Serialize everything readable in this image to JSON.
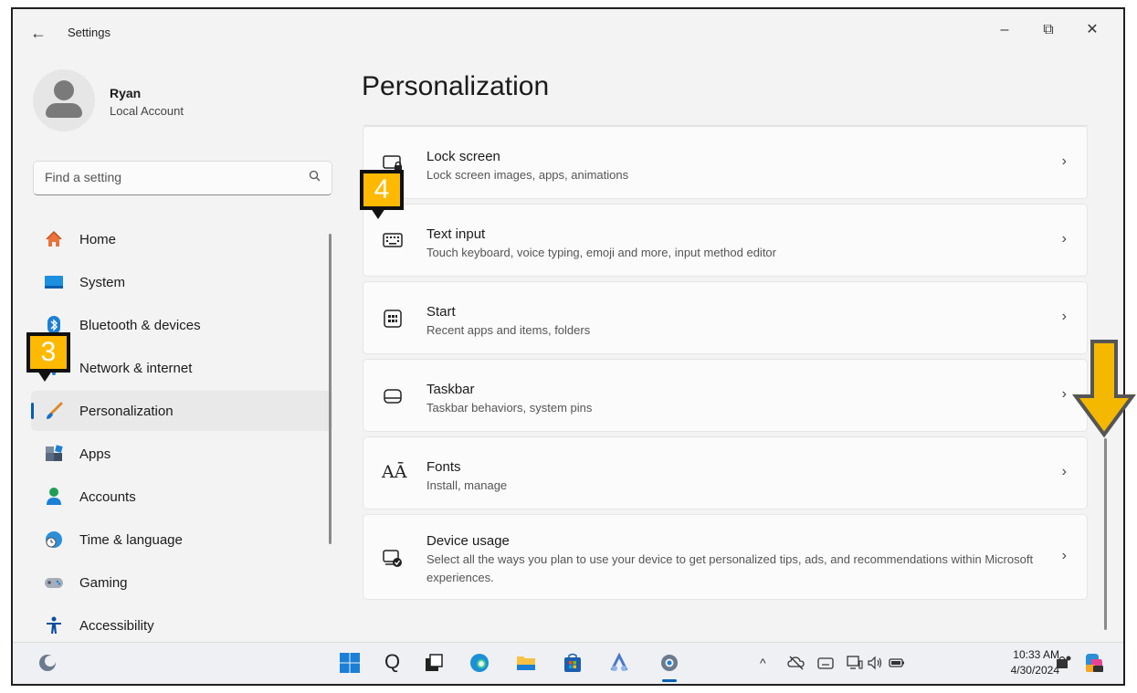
{
  "window": {
    "title": "Settings",
    "back_glyph": "←",
    "min_glyph": "–",
    "max_glyph": "⧉",
    "close_glyph": "✕"
  },
  "profile": {
    "name": "Ryan",
    "account_type": "Local Account"
  },
  "search": {
    "placeholder": "Find a setting",
    "icon": "search-icon"
  },
  "nav": {
    "items": [
      {
        "label": "Home",
        "icon": "home-icon"
      },
      {
        "label": "System",
        "icon": "system-icon"
      },
      {
        "label": "Bluetooth & devices",
        "icon": "bluetooth-icon"
      },
      {
        "label": "Network & internet",
        "icon": "network-icon"
      },
      {
        "label": "Personalization",
        "icon": "brush-icon",
        "active": true
      },
      {
        "label": "Apps",
        "icon": "apps-icon"
      },
      {
        "label": "Accounts",
        "icon": "accounts-icon"
      },
      {
        "label": "Time & language",
        "icon": "globe-clock-icon"
      },
      {
        "label": "Gaming",
        "icon": "gamepad-icon"
      },
      {
        "label": "Accessibility",
        "icon": "accessibility-icon"
      }
    ]
  },
  "main": {
    "title": "Personalization",
    "cards": [
      {
        "title": "Lock screen",
        "desc": "Lock screen images, apps, animations",
        "icon": "lock-screen-icon"
      },
      {
        "title": "Text input",
        "desc": "Touch keyboard, voice typing, emoji and more, input method editor",
        "icon": "keyboard-icon"
      },
      {
        "title": "Start",
        "desc": "Recent apps and items, folders",
        "icon": "start-icon"
      },
      {
        "title": "Taskbar",
        "desc": "Taskbar behaviors, system pins",
        "icon": "taskbar-icon"
      },
      {
        "title": "Fonts",
        "desc": "Install, manage",
        "icon": "fonts-icon"
      },
      {
        "title": "Device usage",
        "desc": "Select all the ways you plan to use your device to get personalized tips, ads, and recommendations within Microsoft experiences.",
        "icon": "device-usage-icon"
      }
    ],
    "chevron": "›"
  },
  "annotations": {
    "step3": "3",
    "step4": "4"
  },
  "taskbar": {
    "time": "10:33 AM",
    "date": "4/30/2024",
    "tray_chevron": "^",
    "fonts_glyph": "AĀ",
    "search_glyph": "Q"
  },
  "colors": {
    "accent": "#005fb8",
    "badge": "#ffb900",
    "arrow": "#f5b800"
  }
}
